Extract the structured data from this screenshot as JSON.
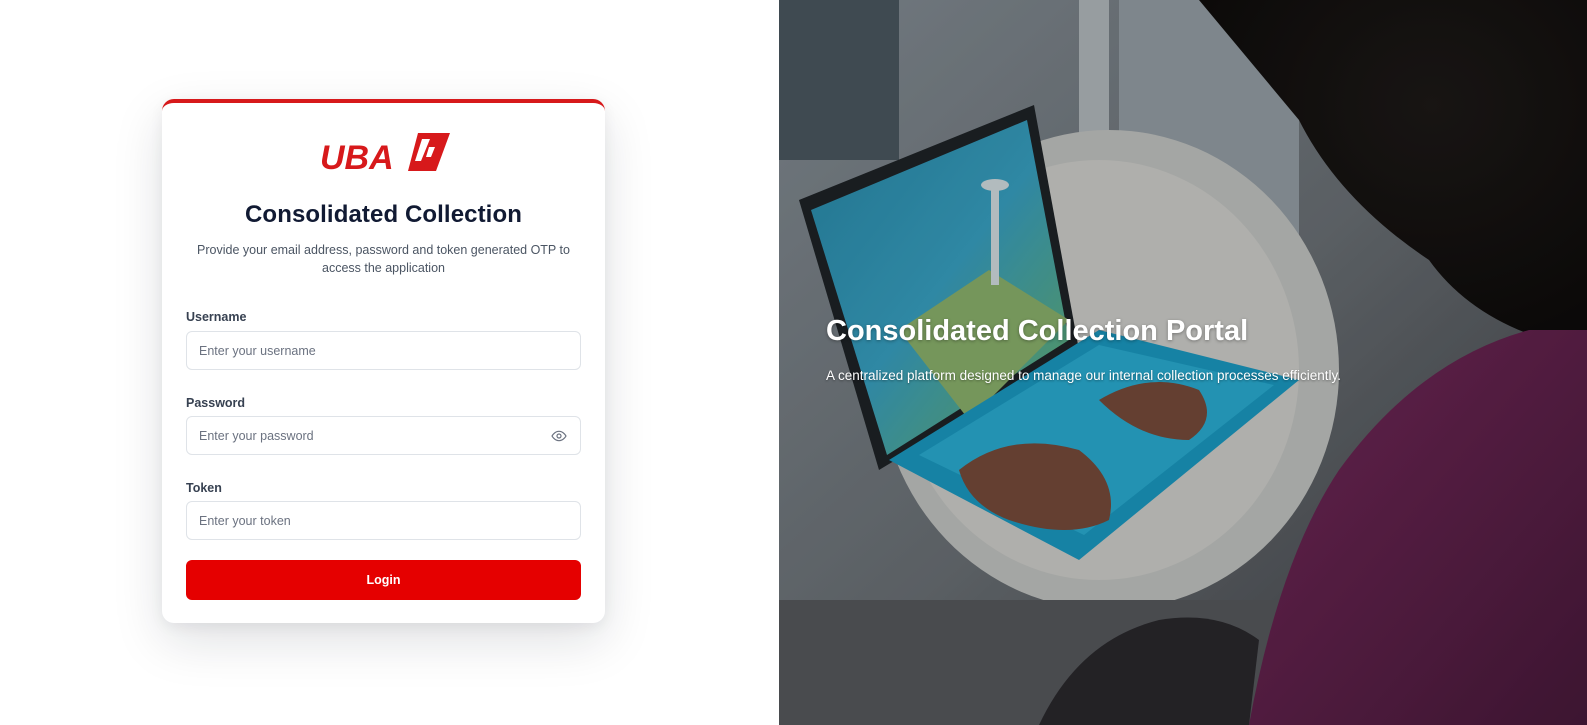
{
  "brand": {
    "logo_text": "UBA",
    "accent_color": "#d7191b",
    "button_color": "#e50000"
  },
  "login_card": {
    "title": "Consolidated Collection",
    "subtitle": "Provide your email address, password and token generated OTP to access the application",
    "username": {
      "label": "Username",
      "placeholder": "Enter your username",
      "value": ""
    },
    "password": {
      "label": "Password",
      "placeholder": "Enter your password",
      "value": "",
      "toggle_icon": "eye-icon"
    },
    "token": {
      "label": "Token",
      "placeholder": "Enter your token",
      "value": ""
    },
    "login_label": "Login"
  },
  "hero": {
    "title": "Consolidated Collection Portal",
    "subtitle": "A centralized platform designed to manage our internal collection processes efficiently."
  }
}
